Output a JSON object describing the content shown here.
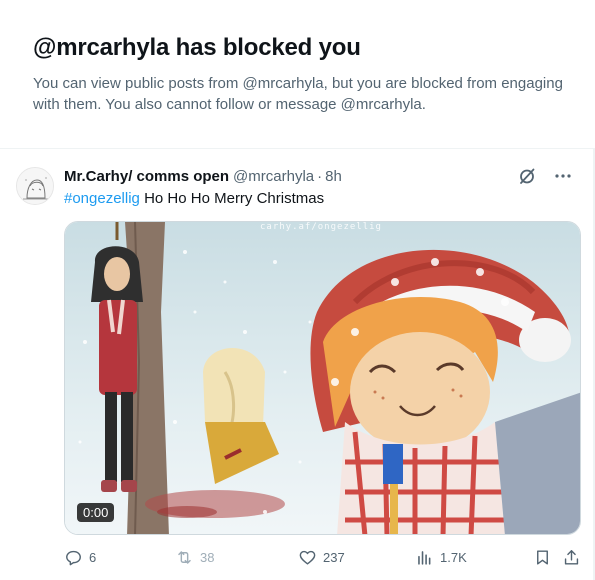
{
  "blocked": {
    "title": "@mrcarhyla has blocked you",
    "description": "You can view public posts from @mrcarhyla, but you are blocked from engaging with them. You also cannot follow or message @mrcarhyla."
  },
  "tweet": {
    "display_name": "Mr.Carhy/ comms open",
    "handle": "@mrcarhyla",
    "separator": "·",
    "time": "8h",
    "hashtag": "#ongezellig",
    "text": " Ho Ho Ho Merry Christmas",
    "media": {
      "watermark": "carhy.af/ongezellig",
      "duration": "0:00"
    },
    "actions": {
      "replies": "6",
      "reposts": "38",
      "likes": "237",
      "views": "1.7K"
    }
  },
  "icons": [
    "grok-icon",
    "more-icon",
    "reply-icon",
    "repost-icon",
    "like-icon",
    "views-icon",
    "bookmark-icon",
    "share-icon"
  ],
  "colors": {
    "accent": "#1d9bf0",
    "muted": "#536471",
    "text": "#0f1419"
  }
}
